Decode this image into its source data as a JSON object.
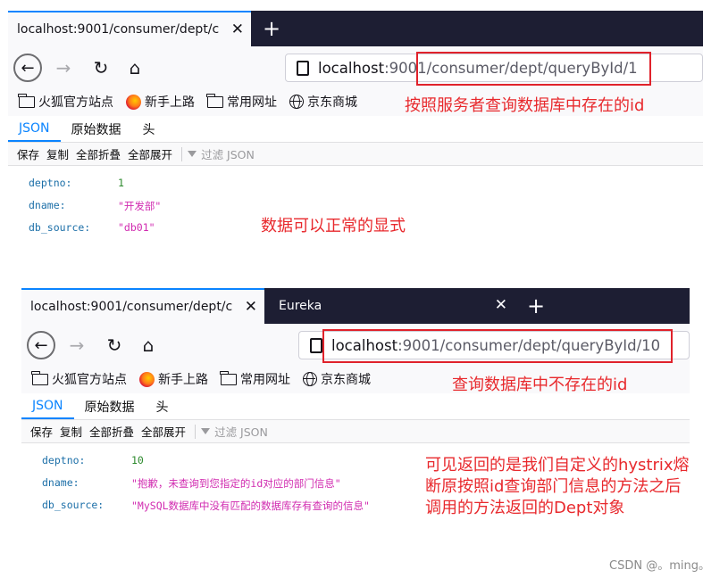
{
  "window1": {
    "tabs": [
      {
        "label": "localhost:9001/consumer/dept/c"
      }
    ],
    "url": {
      "host": "localhost",
      "rest": ":9001/consumer/dept/queryById/1"
    },
    "bookmarks": [
      {
        "label": "火狐官方站点",
        "icon": "folder-icon"
      },
      {
        "label": "新手上路",
        "icon": "firefox-icon"
      },
      {
        "label": "常用网址",
        "icon": "folder-icon"
      },
      {
        "label": "京东商城",
        "icon": "globe-icon"
      }
    ],
    "viewer_tabs": [
      "JSON",
      "原始数据",
      "头"
    ],
    "toolbar": [
      "保存",
      "复制",
      "全部折叠",
      "全部展开"
    ],
    "filter": "过滤 JSON",
    "rows": [
      {
        "key": "deptno:",
        "value": "1",
        "type": "num"
      },
      {
        "key": "dname:",
        "value": "\"开发部\"",
        "type": "str"
      },
      {
        "key": "db_source:",
        "value": "\"db01\"",
        "type": "str"
      }
    ]
  },
  "window2": {
    "tabs": [
      {
        "label": "localhost:9001/consumer/dept/c"
      },
      {
        "label": "Eureka"
      }
    ],
    "url": {
      "host": "localhost",
      "rest": ":9001/consumer/dept/queryById/10"
    },
    "bookmarks": [
      {
        "label": "火狐官方站点",
        "icon": "folder-icon"
      },
      {
        "label": "新手上路",
        "icon": "firefox-icon"
      },
      {
        "label": "常用网址",
        "icon": "folder-icon"
      },
      {
        "label": "京东商城",
        "icon": "globe-icon"
      }
    ],
    "viewer_tabs": [
      "JSON",
      "原始数据",
      "头"
    ],
    "toolbar": [
      "保存",
      "复制",
      "全部折叠",
      "全部展开"
    ],
    "filter": "过滤 JSON",
    "rows": [
      {
        "key": "deptno:",
        "value": "10",
        "type": "num"
      },
      {
        "key": "dname:",
        "value": "\"抱歉，未查询到您指定的id对应的部门信息\"",
        "type": "str"
      },
      {
        "key": "db_source:",
        "value": "\"MySQL数据库中没有匹配的数据库存有查询的信息\"",
        "type": "str"
      }
    ]
  },
  "annotations": {
    "a1": "按照服务者查询数据库中存在的id",
    "a2": "数据可以正常的显式",
    "a3": "查询数据库中不存在的id",
    "a4": "可见返回的是我们自定义的hystrix熔断原按照id查询部门信息的方法之后调用的方法返回的Dept对象"
  },
  "watermark": "CSDN @。ming。",
  "colors": {
    "annotation": "#e8292d",
    "tabbar": "#1d1e33",
    "accent": "#0a84ff"
  }
}
